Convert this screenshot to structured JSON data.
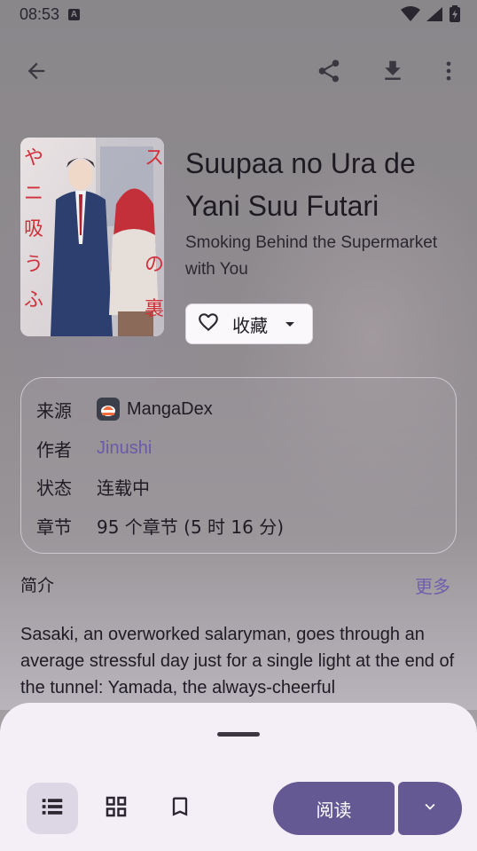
{
  "status_bar": {
    "time": "08:53",
    "badge": "A"
  },
  "manga": {
    "title": "Suupaa no Ura de Yani Suu Futari",
    "subtitle": "Smoking Behind the Supermarket with You",
    "favorite_label": "收藏"
  },
  "info": {
    "source_key": "来源",
    "source_val": "MangaDex",
    "author_key": "作者",
    "author_val": "Jinushi",
    "status_key": "状态",
    "status_val": "连载中",
    "chapters_key": "章节",
    "chapters_val": "95 个章节 (5 时 16 分)"
  },
  "description": {
    "title": "简介",
    "more": "更多",
    "text": "Sasaki, an overworked salaryman, goes through an average stressful day just for a single light at the end of the tunnel: Yamada, the always-cheerful"
  },
  "bottom": {
    "read_label": "阅读"
  },
  "colors": {
    "accent": "#655993",
    "link": "#6a5aa8",
    "sheet": "#f4eff7"
  }
}
